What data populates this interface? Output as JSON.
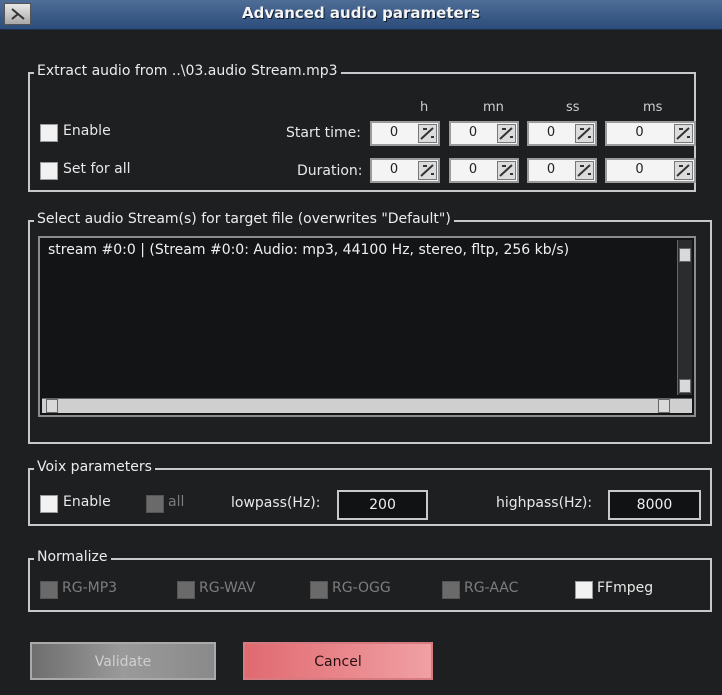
{
  "window": {
    "title": "Advanced audio parameters"
  },
  "extract": {
    "legend": "Extract audio from ..\\03.audio Stream.mp3",
    "columns": [
      "h",
      "mn",
      "ss",
      "ms"
    ],
    "enable_label": "Enable",
    "set_for_all_label": "Set for all",
    "start_time_label": "Start time:",
    "duration_label": "Duration:",
    "start_values": [
      "0",
      "0",
      "0",
      "0"
    ],
    "duration_values": [
      "0",
      "0",
      "0",
      "0"
    ]
  },
  "streams": {
    "legend": "Select audio Stream(s) for target file (overwrites \"Default\")",
    "items": [
      "stream #0:0 | (Stream #0:0: Audio: mp3, 44100 Hz, stereo, fltp, 256 kb/s)"
    ]
  },
  "voix": {
    "legend": "Voix parameters",
    "enable_label": "Enable",
    "all_label": "all",
    "lowpass_label": "lowpass(Hz):",
    "lowpass_value": "200",
    "highpass_label": "highpass(Hz):",
    "highpass_value": "8000"
  },
  "normalize": {
    "legend": "Normalize",
    "options": [
      "RG-MP3",
      "RG-WAV",
      "RG-OGG",
      "RG-AAC",
      "FFmpeg"
    ]
  },
  "buttons": {
    "validate": "Validate",
    "cancel": "Cancel"
  },
  "colors": {
    "titlebar": "#2c4c7a",
    "cancel": "#e77b80",
    "validate": "#8a8a8a"
  }
}
